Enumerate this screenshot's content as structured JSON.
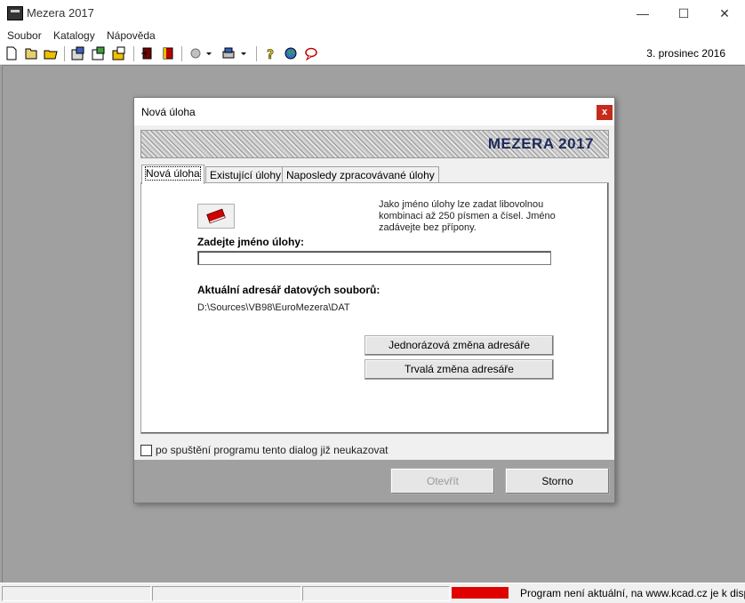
{
  "window": {
    "title": "Mezera 2017",
    "minimize": "—",
    "maximize": "☐",
    "close": "✕"
  },
  "menu": {
    "items": [
      "Soubor",
      "Katalogy",
      "Nápověda"
    ]
  },
  "toolbar": {
    "date": "3. prosinec 2016"
  },
  "dialog": {
    "title": "Nová úloha",
    "close": "x",
    "banner": "MEZERA 2017",
    "tabs": [
      "Nová úloha",
      "Existující úlohy",
      "Naposledy zpracovávané úlohy"
    ],
    "hint": "Jako jméno úlohy lze zadat libovolnou kombinaci až 250 písmen a čísel. Jméno zadávejte bez přípony.",
    "name_label": "Zadejte jméno úlohy:",
    "name_value": "",
    "dir_label": "Aktuální adresář datových souborů:",
    "dir_path": "D:\\Sources\\VB98\\EuroMezera\\DAT",
    "btn_once": "Jednorázová změna adresáře",
    "btn_perm": "Trvalá změna adresáře",
    "checkbox_label": "po spuštění programu tento dialog již neukazovat",
    "btn_open": "Otevřít",
    "btn_cancel": "Storno"
  },
  "status": {
    "message": "Program není aktuální, na www.kcad.cz je k dispc"
  }
}
